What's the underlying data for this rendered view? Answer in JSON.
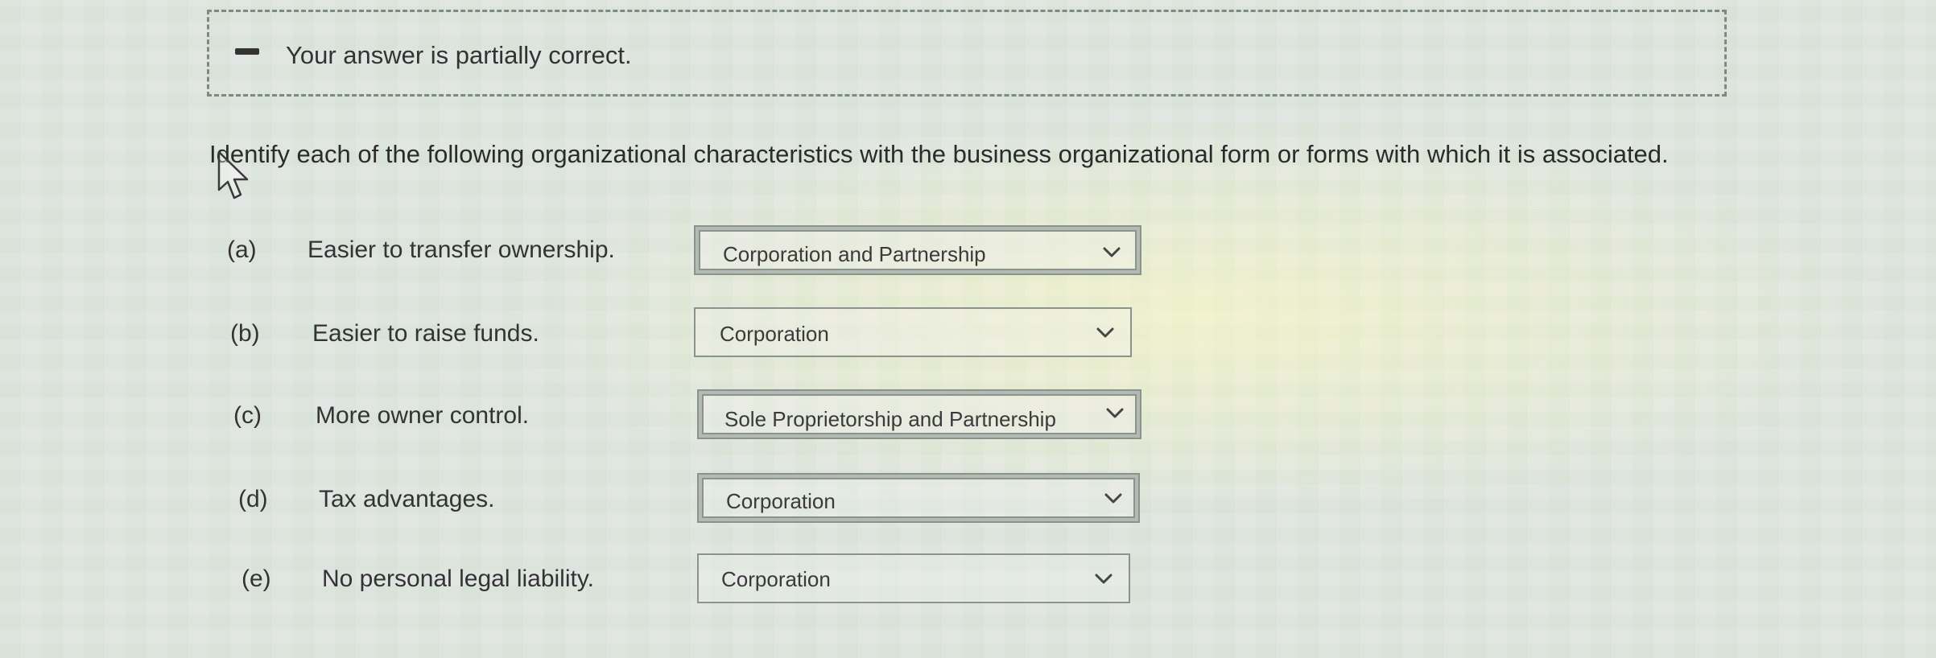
{
  "feedback": {
    "message": "Your answer is partially correct."
  },
  "instruction": "Identify each of the following organizational characteristics with the business organizational form or forms with which it is associated.",
  "questions": [
    {
      "letter": "(a)",
      "text": "Easier to transfer ownership.",
      "selected": "Corporation and Partnership"
    },
    {
      "letter": "(b)",
      "text": "Easier to raise funds.",
      "selected": "Corporation"
    },
    {
      "letter": "(c)",
      "text": "More owner control.",
      "selected": "Sole Proprietorship and Partnership"
    },
    {
      "letter": "(d)",
      "text": "Tax advantages.",
      "selected": "Corporation"
    },
    {
      "letter": "(e)",
      "text": "No personal legal liability.",
      "selected": "Corporation"
    }
  ],
  "icons": {
    "feedback": "minus-icon",
    "cursor": "mouse-pointer-icon",
    "dropdown": "chevron-down-icon"
  }
}
